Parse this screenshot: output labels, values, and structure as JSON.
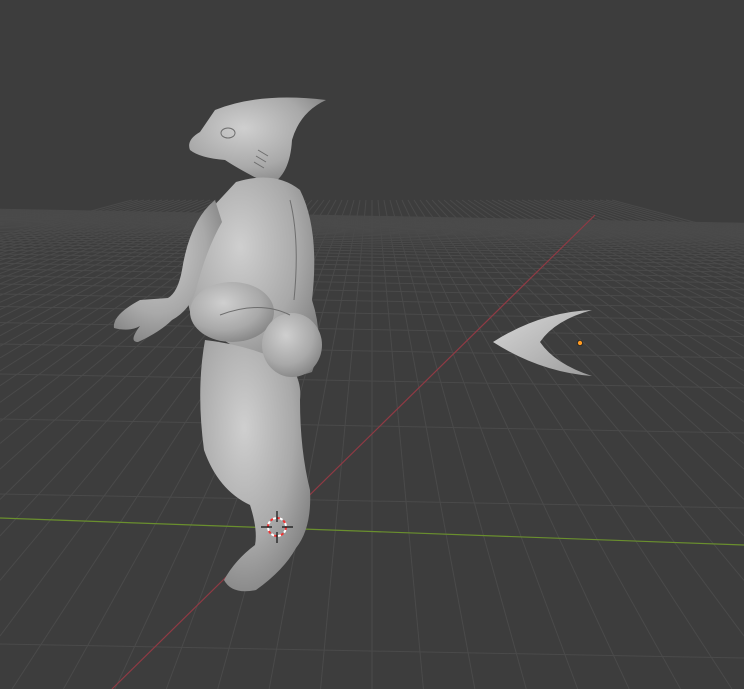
{
  "viewport": {
    "background_color": "#3d3d3d",
    "grid_color": "#4a4a4a",
    "x_axis_color": "#8f3a44",
    "y_axis_color": "#6a8f2e",
    "mesh_color": "#b8b8b8",
    "origin_color": "#ff9b22"
  },
  "icons": {
    "cursor": "3d-cursor-icon",
    "origin": "object-origin-icon"
  }
}
